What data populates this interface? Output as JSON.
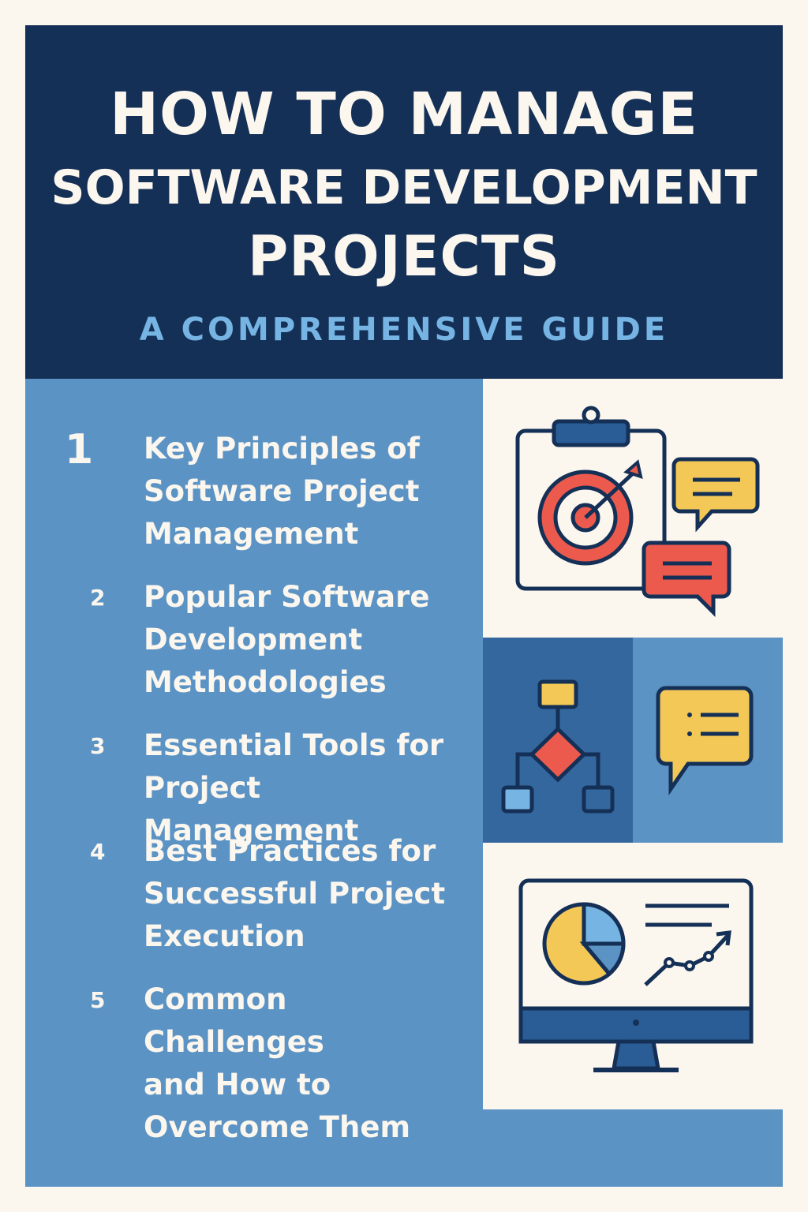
{
  "header": {
    "title_line1": "HOW TO MANAGE",
    "title_line2": "SOFTWARE DEVELOPMENT",
    "title_line3": "PROJECTS",
    "subtitle": "A COMPREHENSIVE GUIDE"
  },
  "sections": [
    {
      "number": "1",
      "title": "Key Principles of\nSoftware Project\nManagement"
    },
    {
      "number": "2",
      "title": "Popular Software\nDevelopment\nMethodologies"
    },
    {
      "number": "3",
      "title": "Essential Tools for\nProject Management"
    },
    {
      "number": "4",
      "title": "Best Practices for\nSuccessful Project\nExecution"
    },
    {
      "number": "5",
      "title": "Common Challenges\nand How to\nOvercome Them"
    }
  ],
  "icons": [
    "clipboard-target-icon",
    "chat-bubbles-icon",
    "flowchart-icon",
    "chat-bubble-icon",
    "monitor-analytics-icon"
  ],
  "colors": {
    "navy": "#153056",
    "panel_blue": "#5b93c4",
    "light_blue": "#76b4e4",
    "cream": "#fbf6ee",
    "red": "#ec5a4d",
    "yellow": "#f4c856"
  }
}
